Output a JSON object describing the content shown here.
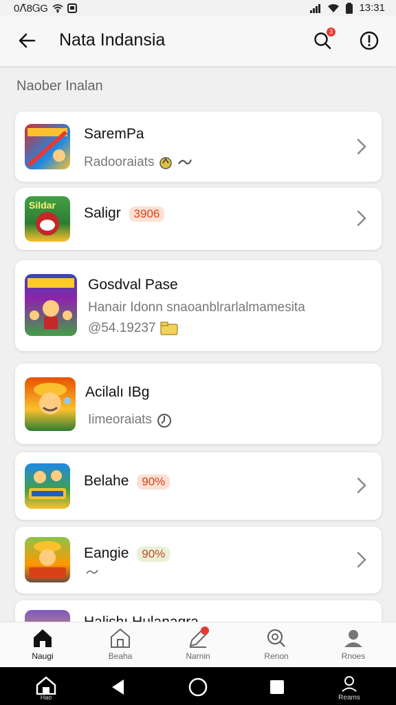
{
  "status_bar": {
    "left_text": "0ꓥ̃8ᏀG",
    "time": "13:31"
  },
  "app_bar": {
    "title": "Nata Indansia",
    "search_badge": "3"
  },
  "section_label": "Naober Inalan",
  "cards": [
    {
      "name": "SaremPa",
      "sub": "Radooraiats",
      "pill": "",
      "extra": ""
    },
    {
      "name": "Saligr",
      "sub": "",
      "pill": "3906",
      "extra": ""
    },
    {
      "name": "Gosdval Pase",
      "sub": "Hanair Idonn snaoanblrarlalmamesita",
      "pill": "",
      "extra": "@54.19237"
    },
    {
      "name": "Acilalı IBg",
      "sub": "Iimeoraiats",
      "pill": "",
      "extra": ""
    },
    {
      "name": "Belahe",
      "sub": "",
      "pill": "90%",
      "extra": ""
    },
    {
      "name": "Eangie",
      "sub": "",
      "pill": "90%",
      "extra": ""
    },
    {
      "name": "Halishı Hulanagra",
      "sub": "",
      "pill": "",
      "extra": ""
    }
  ],
  "bottom_nav": [
    {
      "label": "Naugi",
      "icon": "home-icon"
    },
    {
      "label": "Beaha",
      "icon": "building-icon"
    },
    {
      "label": "Narnin",
      "icon": "edit-icon"
    },
    {
      "label": "Renon",
      "icon": "search-icon"
    },
    {
      "label": "Rnoes",
      "icon": "profile-icon"
    }
  ],
  "system_nav": {
    "home_label": "Hao",
    "profile_label": "Reams"
  },
  "colors": {
    "accent": "#d84315",
    "badge": "#e53935"
  }
}
